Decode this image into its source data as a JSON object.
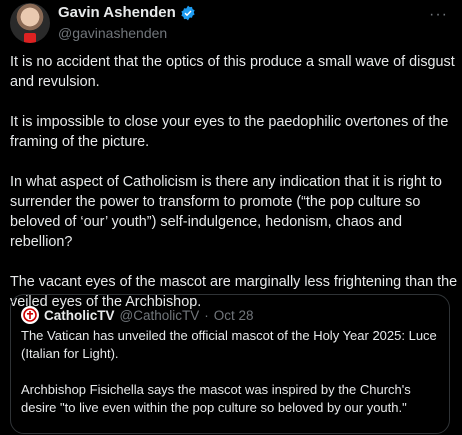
{
  "tweet": {
    "author_name": "Gavin Ashenden",
    "handle": "@gavinashenden",
    "more_label": "···",
    "paragraphs": [
      "It is no accident that the optics of this produce a small wave of disgust and revulsion.",
      "It is impossible to close your eyes to the paedophilic overtones of the framing of the picture.",
      "In what aspect of Catholicism  is there any indication that it is right to surrender the power to transform to promote (“the pop culture so beloved of ‘our’ youth”) self-indulgence, hedonism, chaos and rebellion?",
      "The vacant eyes of the mascot are marginally less frightening than the veiled eyes of the Archbishop."
    ]
  },
  "quoted": {
    "author_name": "CatholicTV",
    "handle": "@CatholicTV",
    "separator": "·",
    "date": "Oct 28",
    "paragraphs": [
      "The Vatican has unveiled the official mascot of the Holy Year 2025: Luce (Italian for Light).",
      "Archbishop Fisichella says the mascot was inspired by the Church's desire \"to live even within the pop culture so beloved by our youth.\""
    ]
  },
  "colors": {
    "background": "#000000",
    "text": "#e7e9ea",
    "muted": "#71767b",
    "verified": "#1d9bf0",
    "border": "#2f3336"
  }
}
